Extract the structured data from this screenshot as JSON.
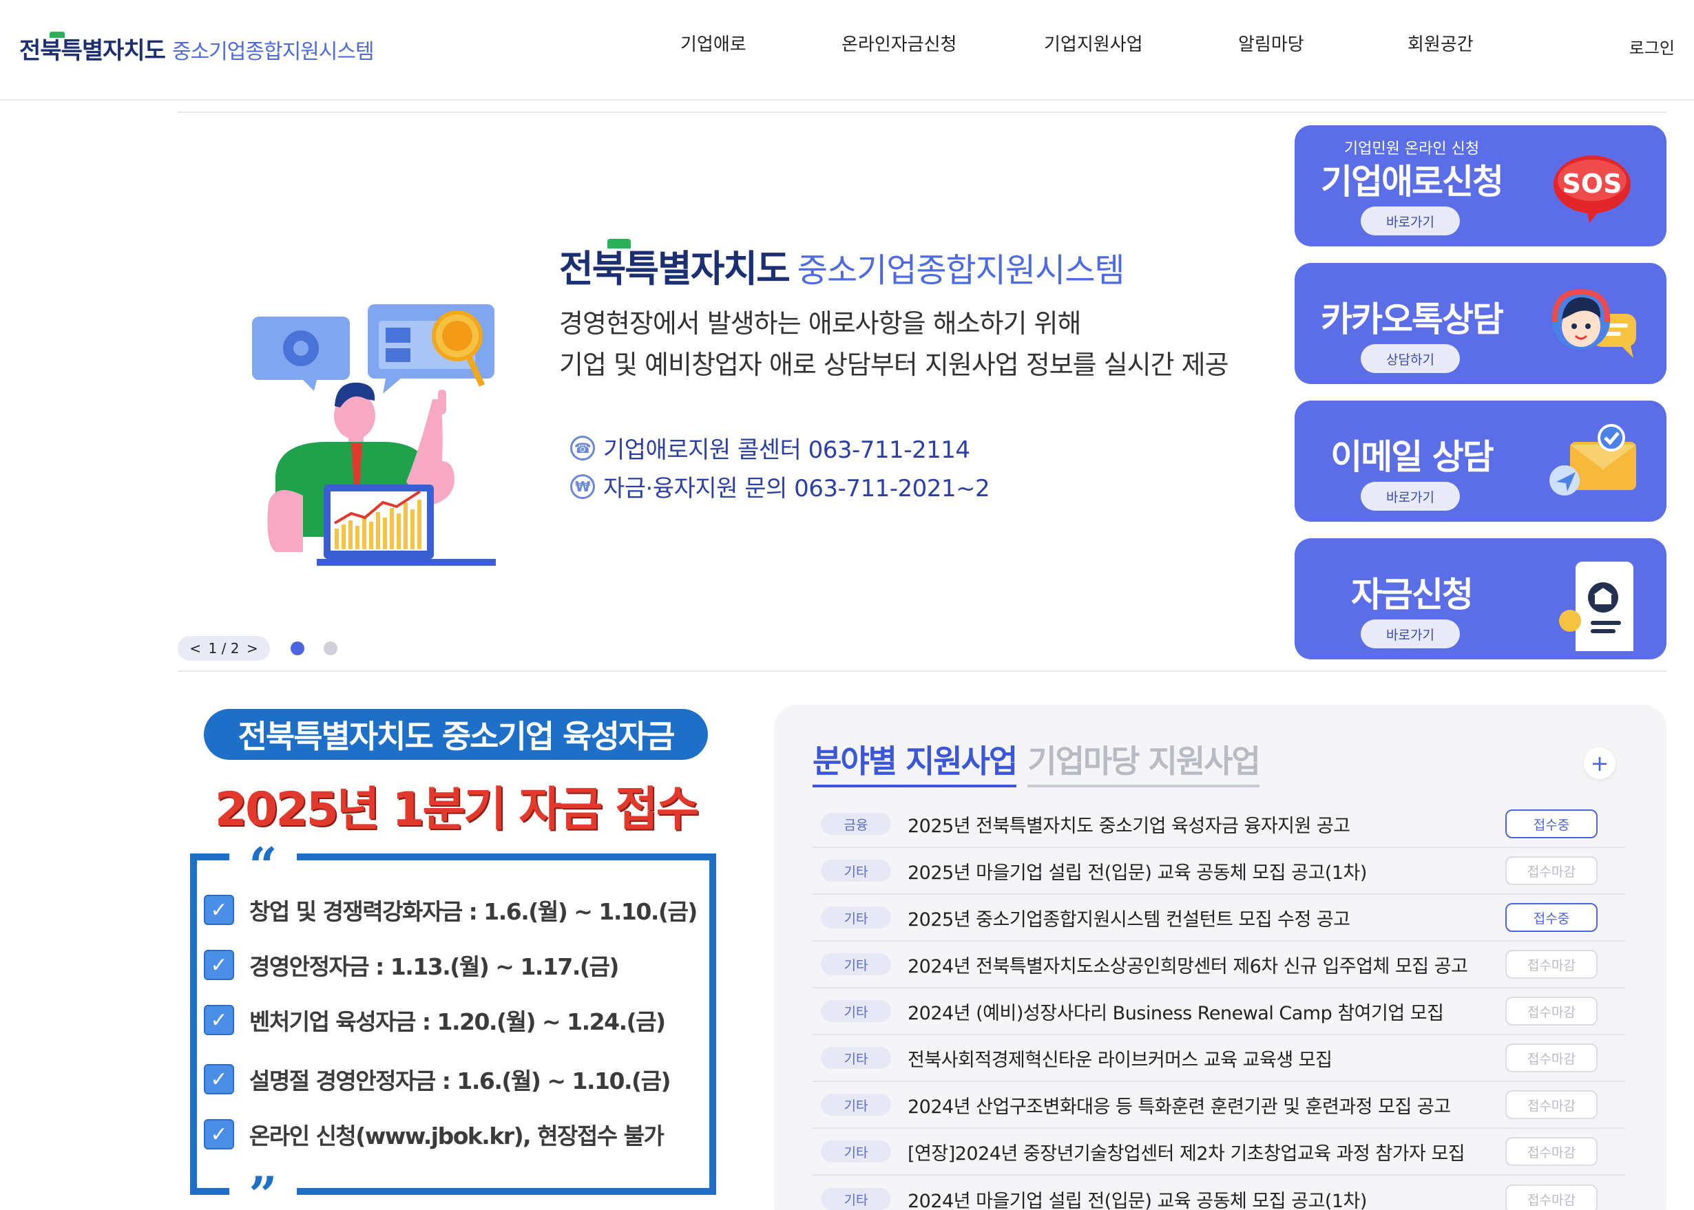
{
  "header": {
    "logo_bold_a": "전",
    "logo_bold_accent": "북",
    "logo_bold_b": "특별자치도",
    "logo_light": "중소기업종합지원시스템",
    "nav": [
      "기업애로",
      "온라인자금신청",
      "기업지원사업",
      "알림마당",
      "회원공간"
    ],
    "login": "로그인"
  },
  "hero": {
    "title_bold_a": "전",
    "title_bold_accent": "북",
    "title_bold_b": "특별자치도",
    "title_light": "중소기업종합지원시스템",
    "desc_line1": "경영현장에서 발생하는 애로사항을 해소하기 위해",
    "desc_line2": "기업 및 예비창업자 애로 상담부터 지원사업 정보를 실시간 제공",
    "contact1": "기업애로지원 콜센터 063-711-2114",
    "contact2": "자금·융자지원 문의 063-711-2021~2",
    "pager": {
      "prev": "<",
      "label": "1 / 2",
      "next": ">"
    }
  },
  "cards": [
    {
      "sub": "기업민원 온라인 신청",
      "title": "기업애로신청",
      "button": "바로가기",
      "icon": "sos-bubble-icon"
    },
    {
      "sub": "",
      "title": "카카오톡상담",
      "button": "상담하기",
      "icon": "chat-agent-icon"
    },
    {
      "sub": "",
      "title": "이메일 상담",
      "button": "바로가기",
      "icon": "mail-envelope-icon"
    },
    {
      "sub": "",
      "title": "자금신청",
      "button": "바로가기",
      "icon": "document-bank-icon"
    }
  ],
  "promo": {
    "pill": "전북특별자치도 중소기업 육성자금",
    "title": "2025년 1분기 자금 접수",
    "quote_open": "“",
    "quote_close": "”",
    "rows": [
      "창업 및 경쟁력강화자금 : 1.6.(월) ~ 1.10.(금)",
      "경영안정자금 : 1.13.(월) ~ 1.17.(금)",
      "벤처기업 육성자금 : 1.20.(월) ~ 1.24.(금)",
      "설명절 경영안정자금 : 1.6.(월) ~ 1.10.(금)",
      "온라인 신청(www.jbok.kr), 현장접수 불가"
    ]
  },
  "support": {
    "tab_active": "분야별 지원사업",
    "tab_inactive": "기업마당 지원사업",
    "more": "+",
    "items": [
      {
        "cat": "금융",
        "title": "2025년 전북특별자치도 중소기업 육성자금 융자지원 공고",
        "status": "접수중",
        "open": true
      },
      {
        "cat": "기타",
        "title": "2025년 마을기업 설립 전(입문) 교육 공동체 모집 공고(1차)",
        "status": "접수마감",
        "open": false
      },
      {
        "cat": "기타",
        "title": "2025년 중소기업종합지원시스템 컨설턴트 모집 수정 공고",
        "status": "접수중",
        "open": true
      },
      {
        "cat": "기타",
        "title": "2024년 전북특별자치도소상공인희망센터 제6차 신규 입주업체 모집 공고",
        "status": "접수마감",
        "open": false
      },
      {
        "cat": "기타",
        "title": "2024년 (예비)성장사다리 Business Renewal Camp 참여기업 모집",
        "status": "접수마감",
        "open": false
      },
      {
        "cat": "기타",
        "title": "전북사회적경제혁신타운 라이브커머스 교육 교육생 모집",
        "status": "접수마감",
        "open": false
      },
      {
        "cat": "기타",
        "title": "2024년 산업구조변화대응 등 특화훈련 훈련기관 및 훈련과정 모집 공고",
        "status": "접수마감",
        "open": false
      },
      {
        "cat": "기타",
        "title": "[연장]2024년 중장년기술창업센터 제2차 기초창업교육 과정 참가자 모집",
        "status": "접수마감",
        "open": false
      },
      {
        "cat": "기타",
        "title": "2024년 마을기업 설립 전(입문) 교육 공동체 모집 공고(1차)",
        "status": "접수마감",
        "open": false
      }
    ]
  }
}
